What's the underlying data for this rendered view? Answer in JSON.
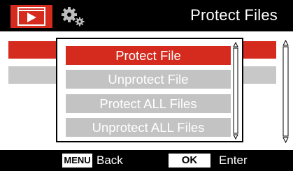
{
  "header": {
    "title": "Protect Files",
    "tabs": [
      {
        "icon": "playback-icon",
        "active": true
      },
      {
        "icon": "settings-gears-icon",
        "active": false
      }
    ]
  },
  "popup": {
    "items": [
      {
        "label": "Protect File",
        "selected": true
      },
      {
        "label": "Unprotect File",
        "selected": false
      },
      {
        "label": "Protect ALL Files",
        "selected": false
      },
      {
        "label": "Unprotect ALL Files",
        "selected": false
      }
    ]
  },
  "footer": {
    "back_key": "MENU",
    "back_label": "Back",
    "enter_key": "OK",
    "enter_label": "Enter"
  },
  "colors": {
    "accent": "#d52b1e",
    "unselected": "#c3c3c3",
    "bar": "#000000",
    "panel": "#ffffff"
  }
}
